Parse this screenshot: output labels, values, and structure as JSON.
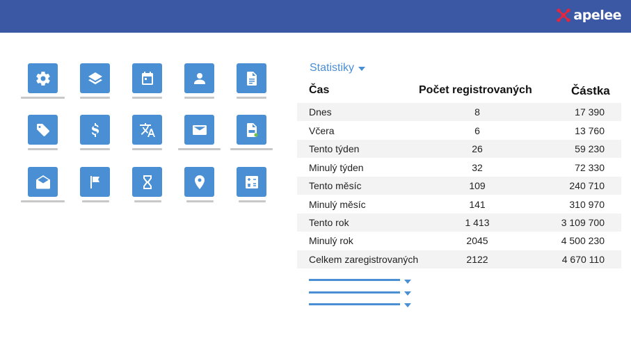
{
  "header": {
    "logo_text": "apelee"
  },
  "icons": [
    {
      "name": "gear-icon"
    },
    {
      "name": "layers-icon"
    },
    {
      "name": "calendar-icon"
    },
    {
      "name": "user-icon"
    },
    {
      "name": "document-icon"
    },
    {
      "name": "tag-icon"
    },
    {
      "name": "dollar-icon"
    },
    {
      "name": "translate-icon"
    },
    {
      "name": "mail-icon"
    },
    {
      "name": "csv-file-icon"
    },
    {
      "name": "open-mail-icon"
    },
    {
      "name": "flag-icon"
    },
    {
      "name": "hourglass-icon"
    },
    {
      "name": "location-pin-icon"
    },
    {
      "name": "calculator-icon"
    }
  ],
  "stats": {
    "title": "Statistiky",
    "columns": [
      "Čas",
      "Počet registrovaných",
      "Částka"
    ],
    "rows": [
      {
        "label": "Dnes",
        "count": "8",
        "amount": "17 390"
      },
      {
        "label": "Včera",
        "count": "6",
        "amount": "13 760"
      },
      {
        "label": "Tento týden",
        "count": "26",
        "amount": "59 230"
      },
      {
        "label": "Minulý týden",
        "count": "32",
        "amount": "72 330"
      },
      {
        "label": "Tento měsíc",
        "count": "109",
        "amount": "240 710"
      },
      {
        "label": "Minulý měsíc",
        "count": "141",
        "amount": "310 970"
      },
      {
        "label": "Tento rok",
        "count": "1 413",
        "amount": "3 109 700"
      },
      {
        "label": "Minulý rok",
        "count": "2045",
        "amount": "4 500 230"
      },
      {
        "label": "Celkem zaregistrovaných",
        "count": "2122",
        "amount": "4 670 110"
      }
    ]
  },
  "colors": {
    "header": "#3a58a3",
    "accent": "#4a8fd3",
    "row_shade": "#f3f3f3"
  }
}
